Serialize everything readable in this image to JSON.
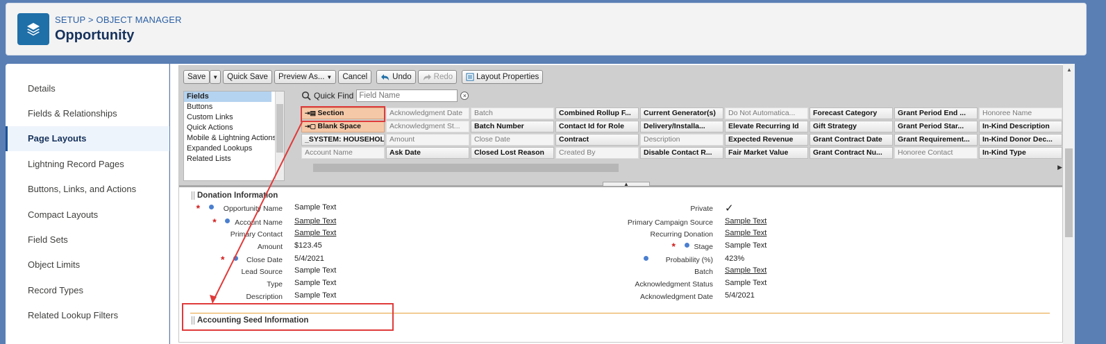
{
  "header": {
    "breadcrumb_setup": "SETUP",
    "breadcrumb_sep": ">",
    "breadcrumb_object_manager": "OBJECT MANAGER",
    "title": "Opportunity",
    "logo_icon": "layers-icon"
  },
  "sidebar": {
    "items": [
      {
        "label": "Details"
      },
      {
        "label": "Fields & Relationships"
      },
      {
        "label": "Page Layouts",
        "active": true
      },
      {
        "label": "Lightning Record Pages"
      },
      {
        "label": "Buttons, Links, and Actions"
      },
      {
        "label": "Compact Layouts"
      },
      {
        "label": "Field Sets"
      },
      {
        "label": "Object Limits"
      },
      {
        "label": "Record Types"
      },
      {
        "label": "Related Lookup Filters"
      }
    ]
  },
  "toolbar": {
    "save": "Save",
    "quick_save": "Quick Save",
    "preview_as": "Preview As...",
    "cancel": "Cancel",
    "undo": "Undo",
    "redo": "Redo",
    "layout_properties": "Layout Properties"
  },
  "categories": [
    "Fields",
    "Buttons",
    "Custom Links",
    "Quick Actions",
    "Mobile & Lightning Actions",
    "Expanded Lookups",
    "Related Lists"
  ],
  "quickfind": {
    "label": "Quick Find",
    "placeholder": "Field Name"
  },
  "palette_columns": [
    [
      "Section",
      "Blank Space",
      "_SYSTEM: HOUSEHOL...",
      "Account Name"
    ],
    [
      "Acknowledgment Date",
      "Acknowledgment St...",
      "Amount",
      "Ask Date"
    ],
    [
      "Batch",
      "Batch Number",
      "Close Date",
      "Closed Lost Reason"
    ],
    [
      "Combined Rollup F...",
      "Contact Id for Role",
      "Contract",
      "Created By"
    ],
    [
      "Current Generator(s)",
      "Delivery/Installa...",
      "Description",
      "Disable Contact R..."
    ],
    [
      "Do Not Automatica...",
      "Elevate Recurring Id",
      "Expected Revenue",
      "Fair Market Value"
    ],
    [
      "Forecast Category",
      "Gift Strategy",
      "Grant Contract Date",
      "Grant Contract Nu..."
    ],
    [
      "Grant Period End ...",
      "Grant Period Star...",
      "Grant Requirement...",
      "Honoree Contact"
    ],
    [
      "Honoree Name",
      "In-Kind Description",
      "In-Kind Donor Dec...",
      "In-Kind Type"
    ]
  ],
  "palette_used": [
    [
      false,
      false,
      false,
      true
    ],
    [
      true,
      true,
      true,
      false
    ],
    [
      true,
      false,
      true,
      false
    ],
    [
      false,
      false,
      false,
      true
    ],
    [
      false,
      false,
      true,
      false
    ],
    [
      true,
      false,
      false,
      false
    ],
    [
      false,
      false,
      false,
      false
    ],
    [
      false,
      false,
      false,
      true
    ],
    [
      true,
      false,
      false,
      false
    ]
  ],
  "sections": {
    "donation": "Donation Information",
    "accounting": "Accounting Seed Information"
  },
  "left_fields": [
    {
      "label": "Opportunity Name",
      "value": "Sample Text",
      "required": true,
      "dot": true,
      "underline": false
    },
    {
      "label": "Account Name",
      "value": "Sample Text",
      "required": true,
      "dot": true,
      "underline": true
    },
    {
      "label": "Primary Contact",
      "value": "Sample Text",
      "required": false,
      "dot": false,
      "underline": true
    },
    {
      "label": "Amount",
      "value": "$123.45",
      "required": false,
      "dot": false,
      "underline": false
    },
    {
      "label": "Close Date",
      "value": "5/4/2021",
      "required": true,
      "dot": true,
      "underline": false
    },
    {
      "label": "Lead Source",
      "value": "Sample Text",
      "required": false,
      "dot": false,
      "underline": false
    },
    {
      "label": "Type",
      "value": "Sample Text",
      "required": false,
      "dot": false,
      "underline": false
    },
    {
      "label": "Description",
      "value": "Sample Text",
      "required": false,
      "dot": false,
      "underline": false
    }
  ],
  "right_fields": [
    {
      "label": "Private",
      "value": "✓",
      "required": false,
      "dot": false,
      "underline": false
    },
    {
      "label": "Primary Campaign Source",
      "value": "Sample Text",
      "required": false,
      "dot": false,
      "underline": true
    },
    {
      "label": "Recurring Donation",
      "value": "Sample Text",
      "required": false,
      "dot": false,
      "underline": true
    },
    {
      "label": "Stage",
      "value": "Sample Text",
      "required": true,
      "dot": true,
      "underline": false
    },
    {
      "label": "Probability (%)",
      "value": "423%",
      "required": false,
      "dot": true,
      "underline": false
    },
    {
      "label": "Batch",
      "value": "Sample Text",
      "required": false,
      "dot": false,
      "underline": true
    },
    {
      "label": "Acknowledgment Status",
      "value": "Sample Text",
      "required": false,
      "dot": false,
      "underline": false
    },
    {
      "label": "Acknowledgment Date",
      "value": "5/4/2021",
      "required": false,
      "dot": false,
      "underline": false
    }
  ],
  "colors": {
    "accent": "#1b5297",
    "highlight": "#e03a3a",
    "section_line": "#e8a13a"
  }
}
